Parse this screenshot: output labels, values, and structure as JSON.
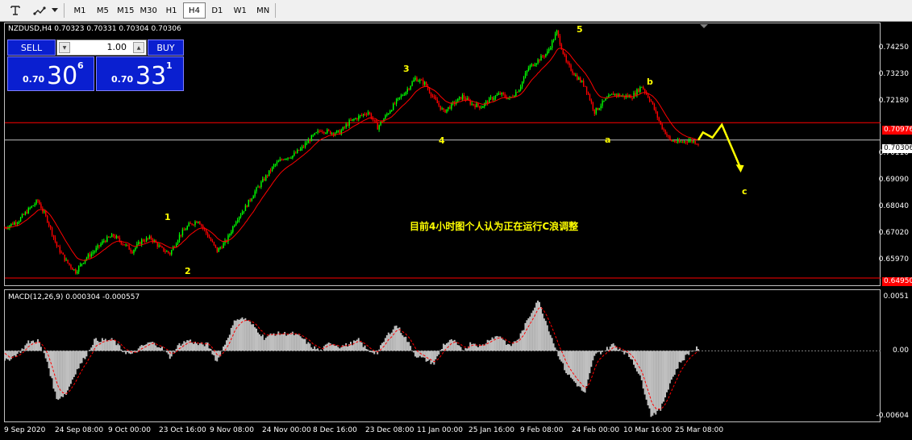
{
  "toolbar": {
    "icons": [
      "crosshair-icon",
      "line-tools-icon",
      "dropdown-arrow-icon"
    ],
    "timeframes": [
      "M1",
      "M5",
      "M15",
      "M30",
      "H1",
      "H4",
      "D1",
      "W1",
      "MN"
    ],
    "active_timeframe": "H4"
  },
  "symbol": {
    "header": "NZDUSD,H4  0.70323 0.70331 0.70304 0.70306"
  },
  "trade_panel": {
    "sell_label": "SELL",
    "buy_label": "BUY",
    "volume": "1.00",
    "sell_prefix": "0.70",
    "sell_big": "30",
    "sell_sup": "6",
    "buy_prefix": "0.70",
    "buy_big": "33",
    "buy_sup": "1"
  },
  "price_scale": [
    "0.74250",
    "0.73230",
    "0.72180",
    "0.71150",
    "0.70110",
    "0.69090",
    "0.68040",
    "0.67020",
    "0.65970",
    "0.64950"
  ],
  "price_tags": {
    "resistance": "0.70976",
    "current": "0.70306",
    "support": "0.64950"
  },
  "macd": {
    "header": "MACD(12,26,9) 0.000304 -0.000557",
    "scale": [
      "0.0051",
      "0.00",
      "-0.00604"
    ]
  },
  "time_axis": [
    "9 Sep 2020",
    "24 Sep 08:00",
    "9 Oct 00:00",
    "23 Oct 16:00",
    "9 Nov 08:00",
    "24 Nov 00:00",
    "8 Dec 16:00",
    "23 Dec 08:00",
    "11 Jan 00:00",
    "25 Jan 16:00",
    "9 Feb 08:00",
    "24 Feb 00:00",
    "10 Mar 16:00",
    "25 Mar 08:00"
  ],
  "wave_labels": [
    "1",
    "2",
    "3",
    "4",
    "5",
    "a",
    "b",
    "c"
  ],
  "annotation": "目前4小时图个人认为正在运行C浪调整",
  "colors": {
    "bull": "#00ff00",
    "bear": "#ff0000",
    "ma": "#ff0000",
    "macd_hist": "#c0c0c0",
    "macd_signal": "#ff0000",
    "resistance": "#ff0000",
    "current": "#c0c0c0",
    "arrow": "#ffff00",
    "panel_blue": "#0a1fd0"
  },
  "chart_data": {
    "type": "candlestick",
    "symbol": "NZDUSD",
    "timeframe": "H4",
    "ylim": [
      0.647,
      0.748
    ],
    "price_path": [
      [
        0,
        0.669
      ],
      [
        3,
        0.672
      ],
      [
        5,
        0.676
      ],
      [
        7,
        0.6795
      ],
      [
        9,
        0.672
      ],
      [
        11,
        0.662
      ],
      [
        13,
        0.656
      ],
      [
        15,
        0.652
      ],
      [
        17,
        0.657
      ],
      [
        19,
        0.66
      ],
      [
        21,
        0.664
      ],
      [
        23,
        0.666
      ],
      [
        25,
        0.663
      ],
      [
        27,
        0.66
      ],
      [
        29,
        0.664
      ],
      [
        31,
        0.665
      ],
      [
        33,
        0.661
      ],
      [
        35,
        0.659
      ],
      [
        37,
        0.666
      ],
      [
        39,
        0.67
      ],
      [
        41,
        0.672
      ],
      [
        43,
        0.666
      ],
      [
        45,
        0.66
      ],
      [
        47,
        0.664
      ],
      [
        49,
        0.672
      ],
      [
        51,
        0.677
      ],
      [
        53,
        0.683
      ],
      [
        55,
        0.688
      ],
      [
        57,
        0.693
      ],
      [
        59,
        0.696
      ],
      [
        61,
        0.697
      ],
      [
        63,
        0.7
      ],
      [
        65,
        0.704
      ],
      [
        67,
        0.707
      ],
      [
        69,
        0.706
      ],
      [
        71,
        0.706
      ],
      [
        73,
        0.71
      ],
      [
        75,
        0.712
      ],
      [
        77,
        0.714
      ],
      [
        79,
        0.708
      ],
      [
        81,
        0.713
      ],
      [
        83,
        0.718
      ],
      [
        85,
        0.722
      ],
      [
        87,
        0.727
      ],
      [
        89,
        0.725
      ],
      [
        91,
        0.719
      ],
      [
        93,
        0.714
      ],
      [
        95,
        0.717
      ],
      [
        97,
        0.72
      ],
      [
        99,
        0.717
      ],
      [
        101,
        0.716
      ],
      [
        103,
        0.719
      ],
      [
        105,
        0.721
      ],
      [
        107,
        0.719
      ],
      [
        109,
        0.723
      ],
      [
        111,
        0.731
      ],
      [
        113,
        0.734
      ],
      [
        115,
        0.737
      ],
      [
        117,
        0.745
      ],
      [
        119,
        0.733
      ],
      [
        121,
        0.728
      ],
      [
        123,
        0.724
      ],
      [
        125,
        0.714
      ],
      [
        127,
        0.718
      ],
      [
        129,
        0.721
      ],
      [
        131,
        0.72
      ],
      [
        133,
        0.72
      ],
      [
        135,
        0.724
      ],
      [
        137,
        0.718
      ],
      [
        139,
        0.709
      ],
      [
        141,
        0.703
      ],
      [
        143,
        0.702
      ],
      [
        145,
        0.703
      ],
      [
        147,
        0.702
      ]
    ],
    "projection": [
      [
        147,
        0.703
      ],
      [
        148,
        0.706
      ],
      [
        150,
        0.704
      ],
      [
        152,
        0.709
      ],
      [
        156,
        0.692
      ]
    ],
    "macd_hist": [
      [
        0,
        -0.001
      ],
      [
        3,
        -0.0002
      ],
      [
        5,
        0.0008
      ],
      [
        7,
        0.001
      ],
      [
        9,
        -0.001
      ],
      [
        11,
        -0.0045
      ],
      [
        13,
        -0.004
      ],
      [
        15,
        -0.002
      ],
      [
        17,
        -0.0006
      ],
      [
        19,
        0.001
      ],
      [
        21,
        0.001
      ],
      [
        23,
        0.001
      ],
      [
        25,
        0.0
      ],
      [
        27,
        -0.0004
      ],
      [
        29,
        0.0004
      ],
      [
        31,
        0.0008
      ],
      [
        33,
        0.0004
      ],
      [
        35,
        -0.0006
      ],
      [
        37,
        0.0006
      ],
      [
        39,
        0.001
      ],
      [
        41,
        0.0006
      ],
      [
        43,
        0.0006
      ],
      [
        45,
        -0.001
      ],
      [
        47,
        0.001
      ],
      [
        49,
        0.003
      ],
      [
        51,
        0.003
      ],
      [
        53,
        0.0022
      ],
      [
        55,
        0.0012
      ],
      [
        57,
        0.0016
      ],
      [
        59,
        0.0016
      ],
      [
        61,
        0.0016
      ],
      [
        63,
        0.0012
      ],
      [
        65,
        0.0004
      ],
      [
        67,
        0.0
      ],
      [
        69,
        0.0008
      ],
      [
        71,
        0.0004
      ],
      [
        73,
        0.0006
      ],
      [
        75,
        0.001
      ],
      [
        77,
        0.0
      ],
      [
        79,
        -0.0002
      ],
      [
        81,
        0.0014
      ],
      [
        83,
        0.0024
      ],
      [
        85,
        0.0012
      ],
      [
        87,
        -0.0004
      ],
      [
        89,
        -0.0008
      ],
      [
        91,
        -0.0012
      ],
      [
        93,
        0.0006
      ],
      [
        95,
        0.001
      ],
      [
        97,
        0.0
      ],
      [
        99,
        0.0008
      ],
      [
        101,
        0.0004
      ],
      [
        103,
        0.0012
      ],
      [
        105,
        0.0014
      ],
      [
        107,
        0.0004
      ],
      [
        109,
        0.0012
      ],
      [
        111,
        0.003
      ],
      [
        113,
        0.0048
      ],
      [
        115,
        0.0024
      ],
      [
        117,
        0.0
      ],
      [
        119,
        -0.002
      ],
      [
        121,
        -0.003
      ],
      [
        123,
        -0.004
      ],
      [
        125,
        -0.0004
      ],
      [
        127,
        0.0
      ],
      [
        129,
        0.0006
      ],
      [
        131,
        0.0
      ],
      [
        133,
        -0.0008
      ],
      [
        135,
        -0.0028
      ],
      [
        137,
        -0.006
      ],
      [
        139,
        -0.0055
      ],
      [
        141,
        -0.003
      ],
      [
        143,
        -0.0012
      ],
      [
        145,
        -0.0002
      ],
      [
        147,
        0.0003
      ]
    ],
    "macd_ylim": [
      -0.0065,
      0.0055
    ]
  }
}
